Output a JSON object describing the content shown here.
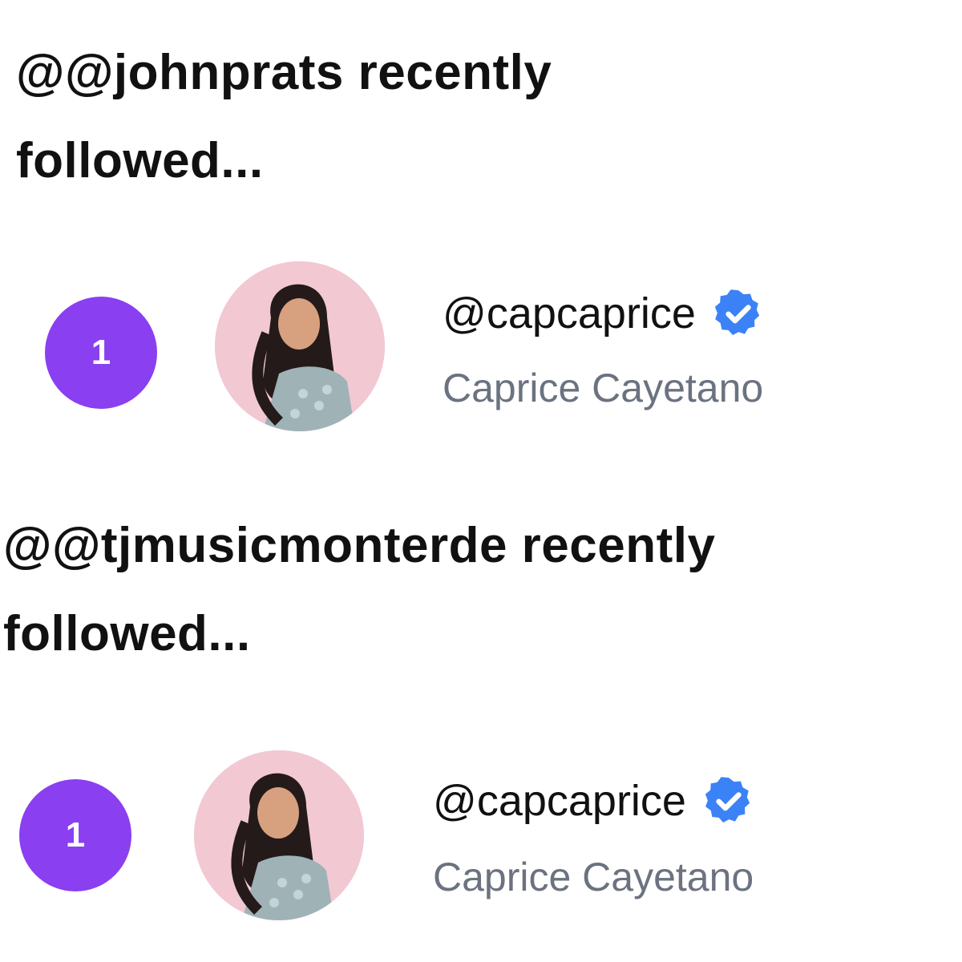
{
  "sections": [
    {
      "heading_line1": "@@johnprats recently",
      "heading_line2": "followed...",
      "item": {
        "rank": "1",
        "handle": "@capcaprice",
        "display_name": "Caprice Cayetano",
        "verified_icon": "verified-badge-icon",
        "avatar_icon": "avatar-photo"
      }
    },
    {
      "heading_line1": "@@tjmusicmonterde recently",
      "heading_line2": "followed...",
      "item": {
        "rank": "1",
        "handle": "@capcaprice",
        "display_name": "Caprice Cayetano",
        "verified_icon": "verified-badge-icon",
        "avatar_icon": "avatar-photo"
      }
    }
  ],
  "colors": {
    "badge": "#8a3ff0",
    "verified": "#3b82f6",
    "secondary_text": "#6b7280",
    "avatar_bg": "#f2c8d3"
  }
}
